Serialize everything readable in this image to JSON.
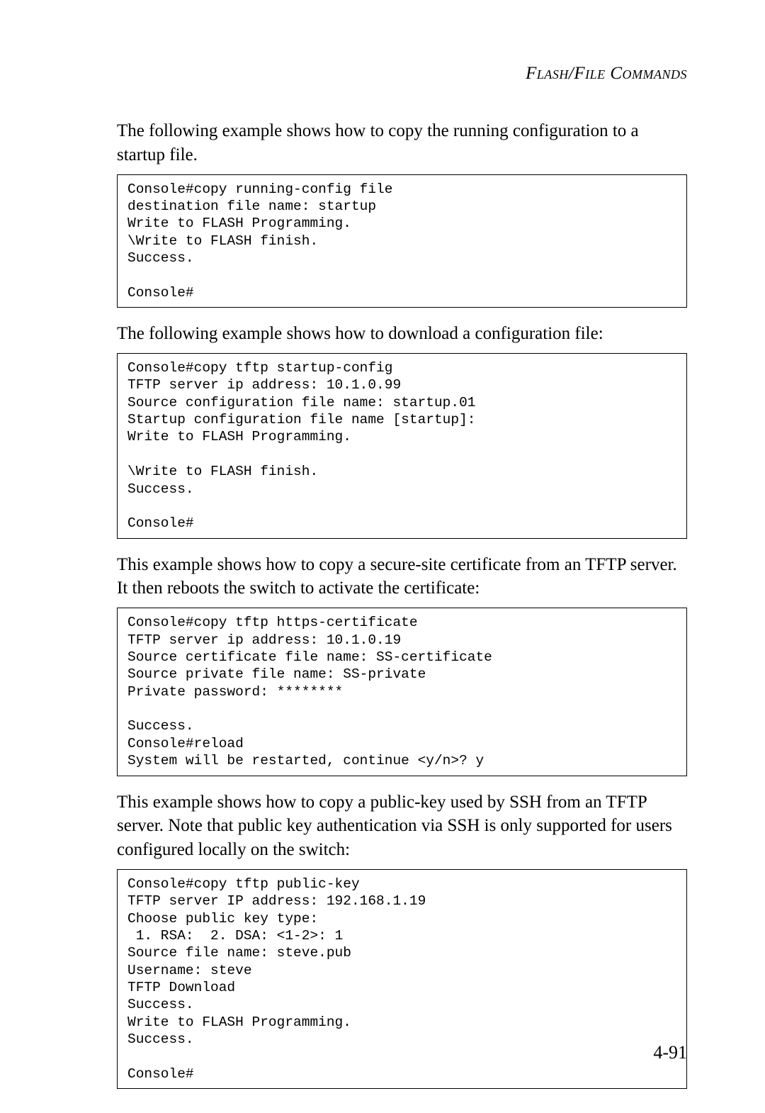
{
  "header": {
    "title": "Flash/File Commands"
  },
  "paragraphs": {
    "p1": "The following example shows how to copy the running configuration to a startup file.",
    "p2": "The following example shows how to download a configuration file:",
    "p3": "This example shows how to copy a secure-site certificate from an TFTP server. It then reboots the switch to activate the certificate:",
    "p4": "This example shows how to copy a public-key used by SSH from an TFTP server. Note that public key authentication via SSH is only supported for users configured locally on the switch:"
  },
  "code": {
    "c1": "Console#copy running-config file\ndestination file name: startup\nWrite to FLASH Programming.\n\\Write to FLASH finish.\nSuccess.\n\nConsole#",
    "c2": "Console#copy tftp startup-config\nTFTP server ip address: 10.1.0.99\nSource configuration file name: startup.01\nStartup configuration file name [startup]:\nWrite to FLASH Programming.\n\n\\Write to FLASH finish.\nSuccess.\n\nConsole#",
    "c3": "Console#copy tftp https-certificate\nTFTP server ip address: 10.1.0.19\nSource certificate file name: SS-certificate\nSource private file name: SS-private\nPrivate password: ********\n\nSuccess.\nConsole#reload\nSystem will be restarted, continue <y/n>? y",
    "c4": "Console#copy tftp public-key\nTFTP server IP address: 192.168.1.19\nChoose public key type:\n 1. RSA:  2. DSA: <1-2>: 1\nSource file name: steve.pub\nUsername: steve\nTFTP Download\nSuccess.\nWrite to FLASH Programming.\nSuccess.\n\nConsole#"
  },
  "page_number": "4-91"
}
